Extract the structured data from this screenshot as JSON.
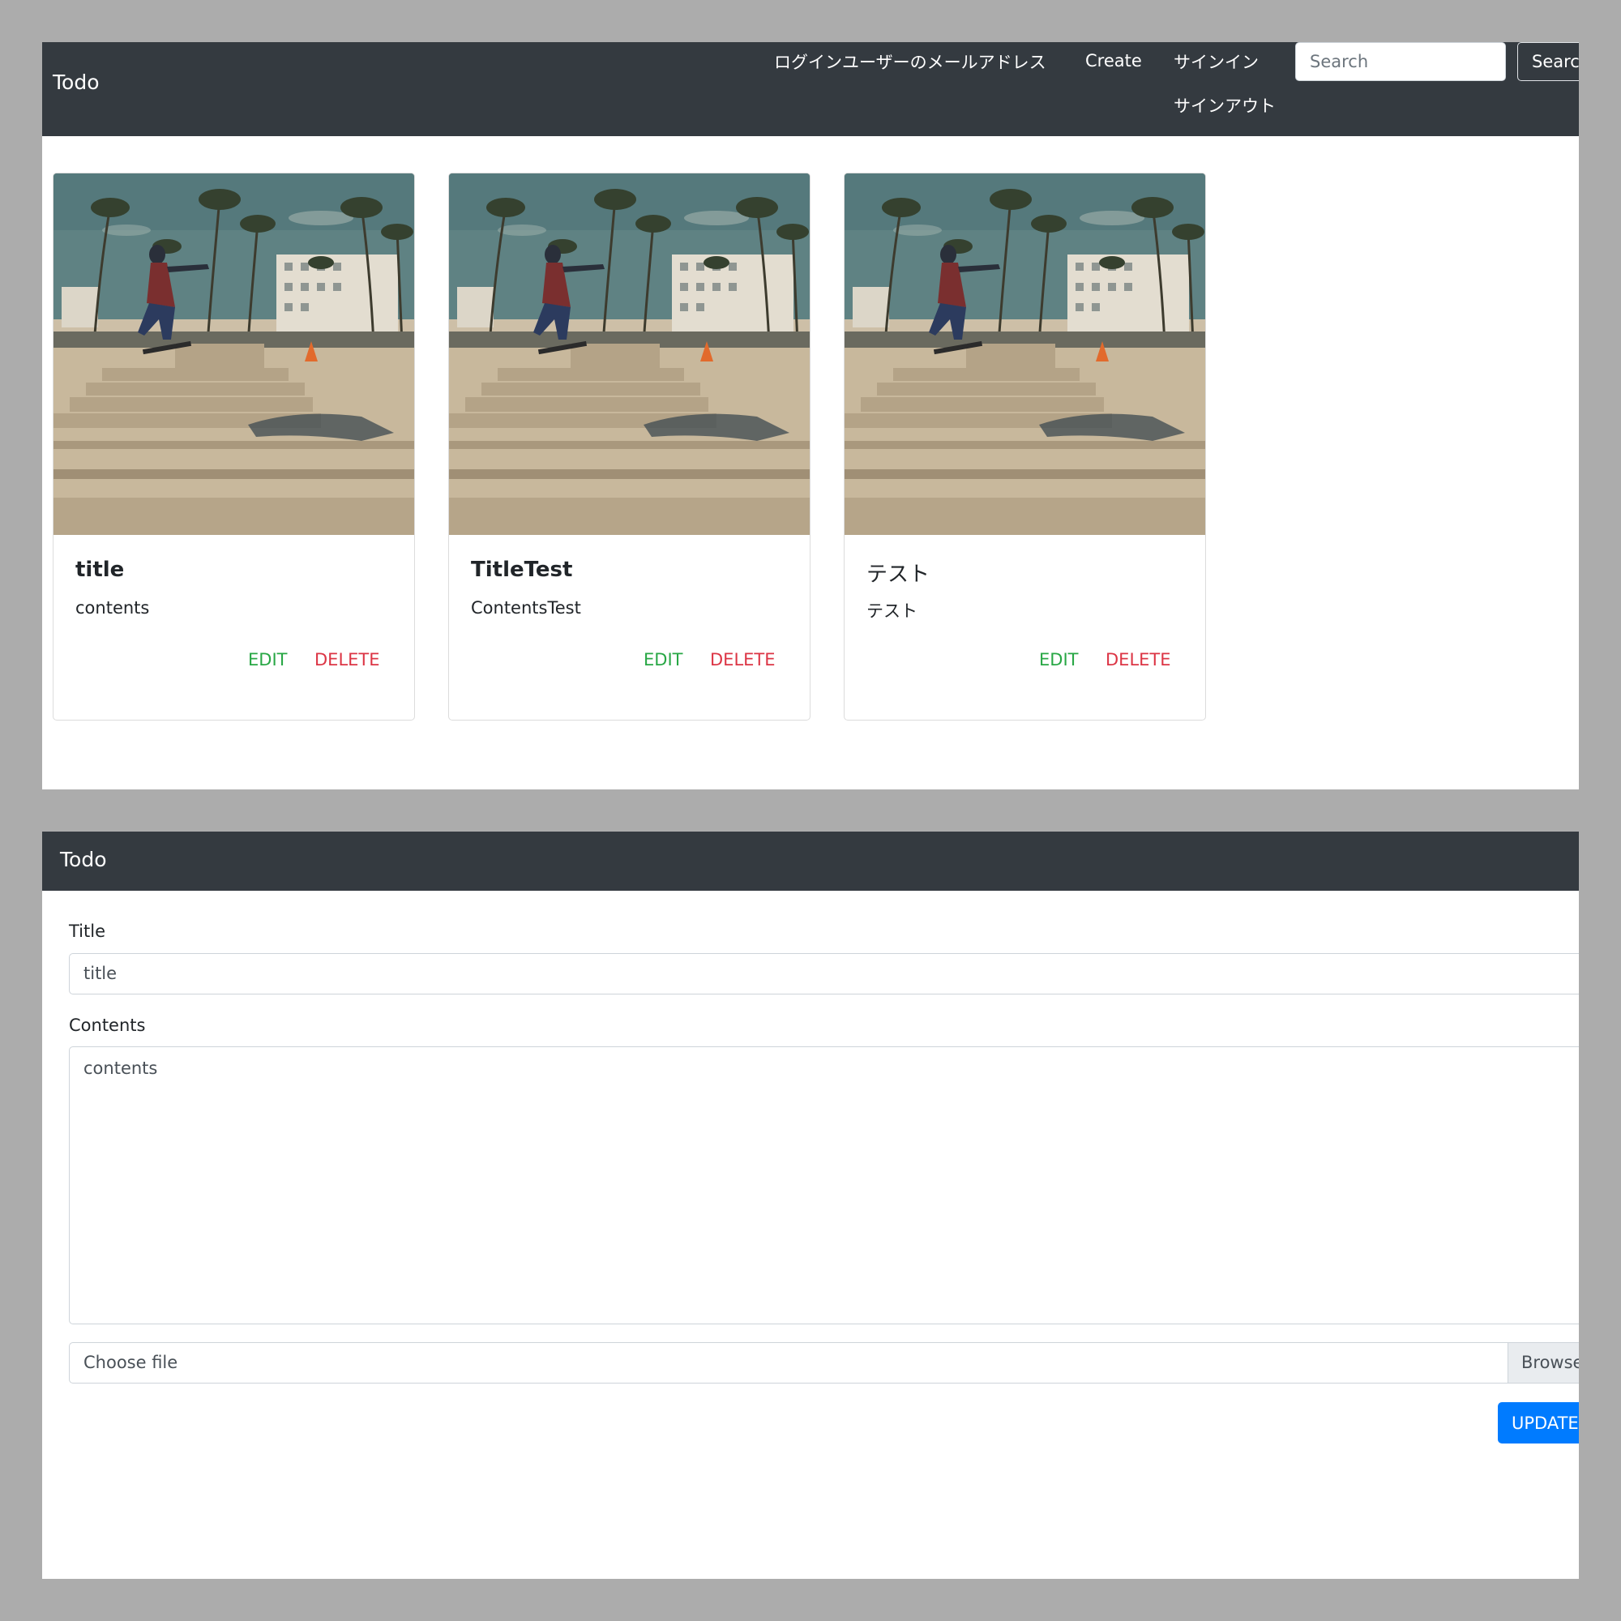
{
  "list_page": {
    "brand": "Todo",
    "nav": {
      "email": "ログインユーザーのメールアドレス",
      "create": "Create",
      "signin": "サインイン",
      "signout": "サインアウト"
    },
    "search": {
      "placeholder": "Search",
      "button": "Search"
    },
    "cards": [
      {
        "title": "title",
        "contents": "contents",
        "edit": "EDIT",
        "delete": "DELETE",
        "image": "skateboarder-photo"
      },
      {
        "title": "TitleTest",
        "contents": "ContentsTest",
        "edit": "EDIT",
        "delete": "DELETE",
        "image": "skateboarder-photo"
      },
      {
        "title": "テスト",
        "contents": "テスト",
        "edit": "EDIT",
        "delete": "DELETE",
        "image": "skateboarder-photo"
      }
    ]
  },
  "edit_page": {
    "brand": "Todo",
    "title_label": "Title",
    "title_value": "title",
    "contents_label": "Contents",
    "contents_value": "contents",
    "file": {
      "label": "Choose file",
      "browse": "Browse"
    },
    "update_button": "UPDATE"
  },
  "colors": {
    "navbar": "#343a40",
    "edit_link": "#28a745",
    "delete_link": "#dc3545",
    "primary_button": "#007bff",
    "backdrop": "#acacac"
  }
}
